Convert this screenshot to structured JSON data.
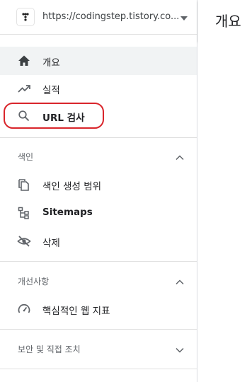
{
  "property": {
    "url": "https://codingstep.tistory.co...",
    "site_icon": "tistory-dots-icon"
  },
  "nav": {
    "overview": {
      "label": "개요",
      "icon": "home-icon"
    },
    "performance": {
      "label": "실적",
      "icon": "trending-up-icon"
    },
    "url_inspection": {
      "label": "URL 검사",
      "icon": "search-icon"
    }
  },
  "index_section": {
    "title": "색인",
    "items": [
      {
        "label": "색인 생성 범위",
        "icon": "copy-pages-icon"
      },
      {
        "label": "Sitemaps",
        "icon": "sitemap-icon"
      },
      {
        "label": "삭제",
        "icon": "eye-off-icon"
      }
    ]
  },
  "enhancements_section": {
    "title": "개선사항",
    "items": [
      {
        "label": "핵심적인 웹 지표",
        "icon": "speedometer-icon"
      }
    ]
  },
  "security_section": {
    "title": "보안 및 직접 조치"
  },
  "main": {
    "title": "개요"
  },
  "colors": {
    "highlight": "#d9252b",
    "active_bg": "#f1f3f4",
    "icon": "#5f6368",
    "home_icon": "#3c4043"
  }
}
